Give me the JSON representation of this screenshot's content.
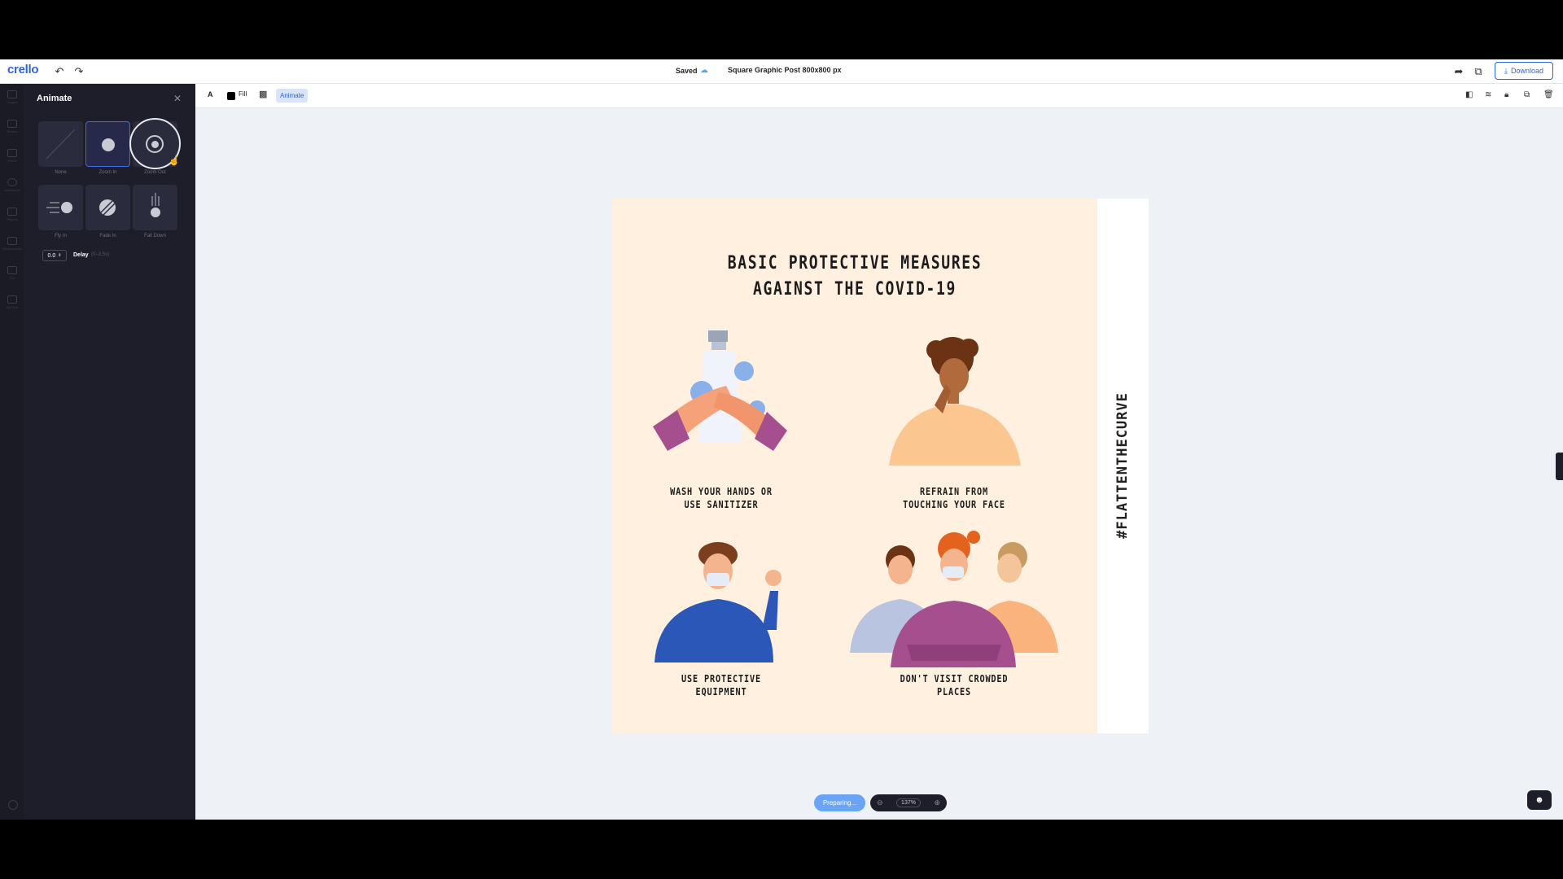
{
  "app": {
    "logo": "crello",
    "saved_label": "Saved",
    "doc_title": "Square Graphic Post 800x800 px",
    "download_label": "Download"
  },
  "rail": {
    "items": [
      "Images",
      "Photos",
      "Videos",
      "Animations",
      "Objects",
      "Backgrounds",
      "Text",
      "My Files"
    ]
  },
  "panel": {
    "title": "Animate",
    "animations": [
      {
        "label": "None",
        "selected": false
      },
      {
        "label": "Zoom In",
        "selected": true
      },
      {
        "label": "Zoom Out",
        "selected": false
      },
      {
        "label": "Fly In",
        "selected": false
      },
      {
        "label": "Fade In",
        "selected": false
      },
      {
        "label": "Fall Down",
        "selected": false
      }
    ],
    "delay_value": "0.0",
    "delay_label": "Delay",
    "delay_hint": "(0–3.5s)"
  },
  "toolbar": {
    "text_label": "A",
    "fill_label": "Fill",
    "animate_label": "Animate"
  },
  "poster": {
    "title_line1": "BASIC PROTECTIVE MEASURES",
    "title_line2": "AGAINST THE COVID-19",
    "cap1_line1": "WASH YOUR HANDS OR",
    "cap1_line2": "USE SANITIZER",
    "cap2_line1": "REFRAIN FROM",
    "cap2_line2": "TOUCHING YOUR FACE",
    "cap3_line1": "USE PROTECTIVE",
    "cap3_line2": "EQUIPMENT",
    "cap4_line1": "DON'T VISIT CROWDED",
    "cap4_line2": "PLACES",
    "hashtag": "#FLATTENTHECURVE"
  },
  "bottom": {
    "preparing_label": "Preparing...",
    "zoom_value": "137%"
  },
  "colors": {
    "accent": "#2f64d8",
    "panel_bg": "#1d1e29",
    "poster_bg": "#fff0df"
  }
}
